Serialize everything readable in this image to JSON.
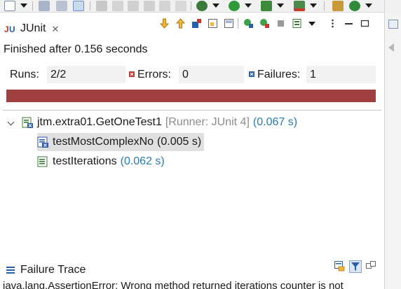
{
  "view": {
    "tab_label": "JUnit",
    "tab_close": "✕"
  },
  "status": {
    "text": "Finished after 0.156 seconds"
  },
  "counters": {
    "runs_label": "Runs:",
    "runs_value": "2/2",
    "errors_label": "Errors:",
    "errors_value": "0",
    "failures_label": "Failures:",
    "failures_value": "1"
  },
  "progress": {
    "fraction": 1.0,
    "color": "#a0403e"
  },
  "tree": {
    "root": {
      "name": "jtm.extra01.GetOneTest1",
      "runner": "[Runner: JUnit 4]",
      "time": "(0.067 s)"
    },
    "children": [
      {
        "name": "testMostComplexNo",
        "time": "(0.005 s)",
        "status": "failed",
        "selected": true
      },
      {
        "name": "testIterations",
        "time": "(0.062 s)",
        "status": "passed",
        "selected": false
      }
    ]
  },
  "trace": {
    "title": "Failure Trace",
    "first_line": "java.lang.AssertionError: Wrong method returned   iterations counter is not"
  },
  "colors": {
    "failure_red": "#a0403e",
    "time_blue": "#2b7bb0",
    "selected_bg": "#e0e0e0"
  }
}
